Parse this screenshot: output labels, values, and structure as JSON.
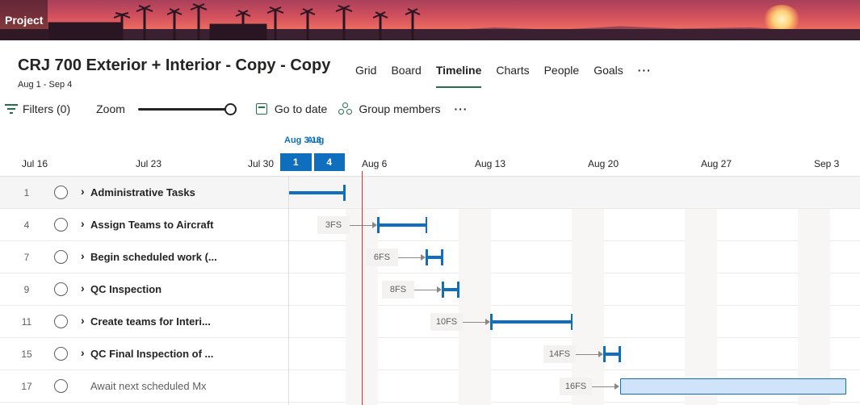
{
  "banner": {
    "title": "Project"
  },
  "plan": {
    "title": "CRJ 700 Exterior + Interior - Copy - Copy",
    "dates": "Aug 1 - Sep 4"
  },
  "tabs": [
    {
      "label": "Grid"
    },
    {
      "label": "Board"
    },
    {
      "label": "Timeline",
      "active": true
    },
    {
      "label": "Charts"
    },
    {
      "label": "People"
    },
    {
      "label": "Goals"
    },
    {
      "label": "···"
    }
  ],
  "toolbar": {
    "filters_label": "Filters (0)",
    "zoom_label": "Zoom",
    "zoom_level": 1.0,
    "goto_label": "Go to date",
    "group_label": "Group members",
    "more_label": "···"
  },
  "timeline": {
    "date_labels": [
      "Jul 16",
      "Jul 23",
      "Jul 30",
      "Aug 6",
      "Aug 13",
      "Aug 20",
      "Aug 27",
      "Sep 3"
    ],
    "today_caption_a": "Aug 3.13",
    "today_caption_b": "Aug",
    "today_seg_1": "1",
    "today_seg_2": "4"
  },
  "tasks": [
    {
      "num": "1",
      "name": "Administrative Tasks",
      "summary": true
    },
    {
      "num": "4",
      "name": "Assign Teams to Aircraft",
      "summary": true,
      "dep": "3FS"
    },
    {
      "num": "7",
      "name": "Begin scheduled work (...",
      "summary": true,
      "dep": "6FS"
    },
    {
      "num": "9",
      "name": "QC Inspection",
      "summary": true,
      "dep": "8FS"
    },
    {
      "num": "11",
      "name": "Create teams for Interi...",
      "summary": true,
      "dep": "10FS"
    },
    {
      "num": "15",
      "name": "QC Final Inspection of ...",
      "summary": true,
      "dep": "14FS"
    },
    {
      "num": "17",
      "name": "Await next scheduled Mx",
      "summary": false,
      "dep": "16FS"
    }
  ],
  "colors": {
    "accent": "#217346",
    "bar": "#106ebe",
    "today_line": "#d13438",
    "leaf_fill": "#cfe4fa"
  }
}
